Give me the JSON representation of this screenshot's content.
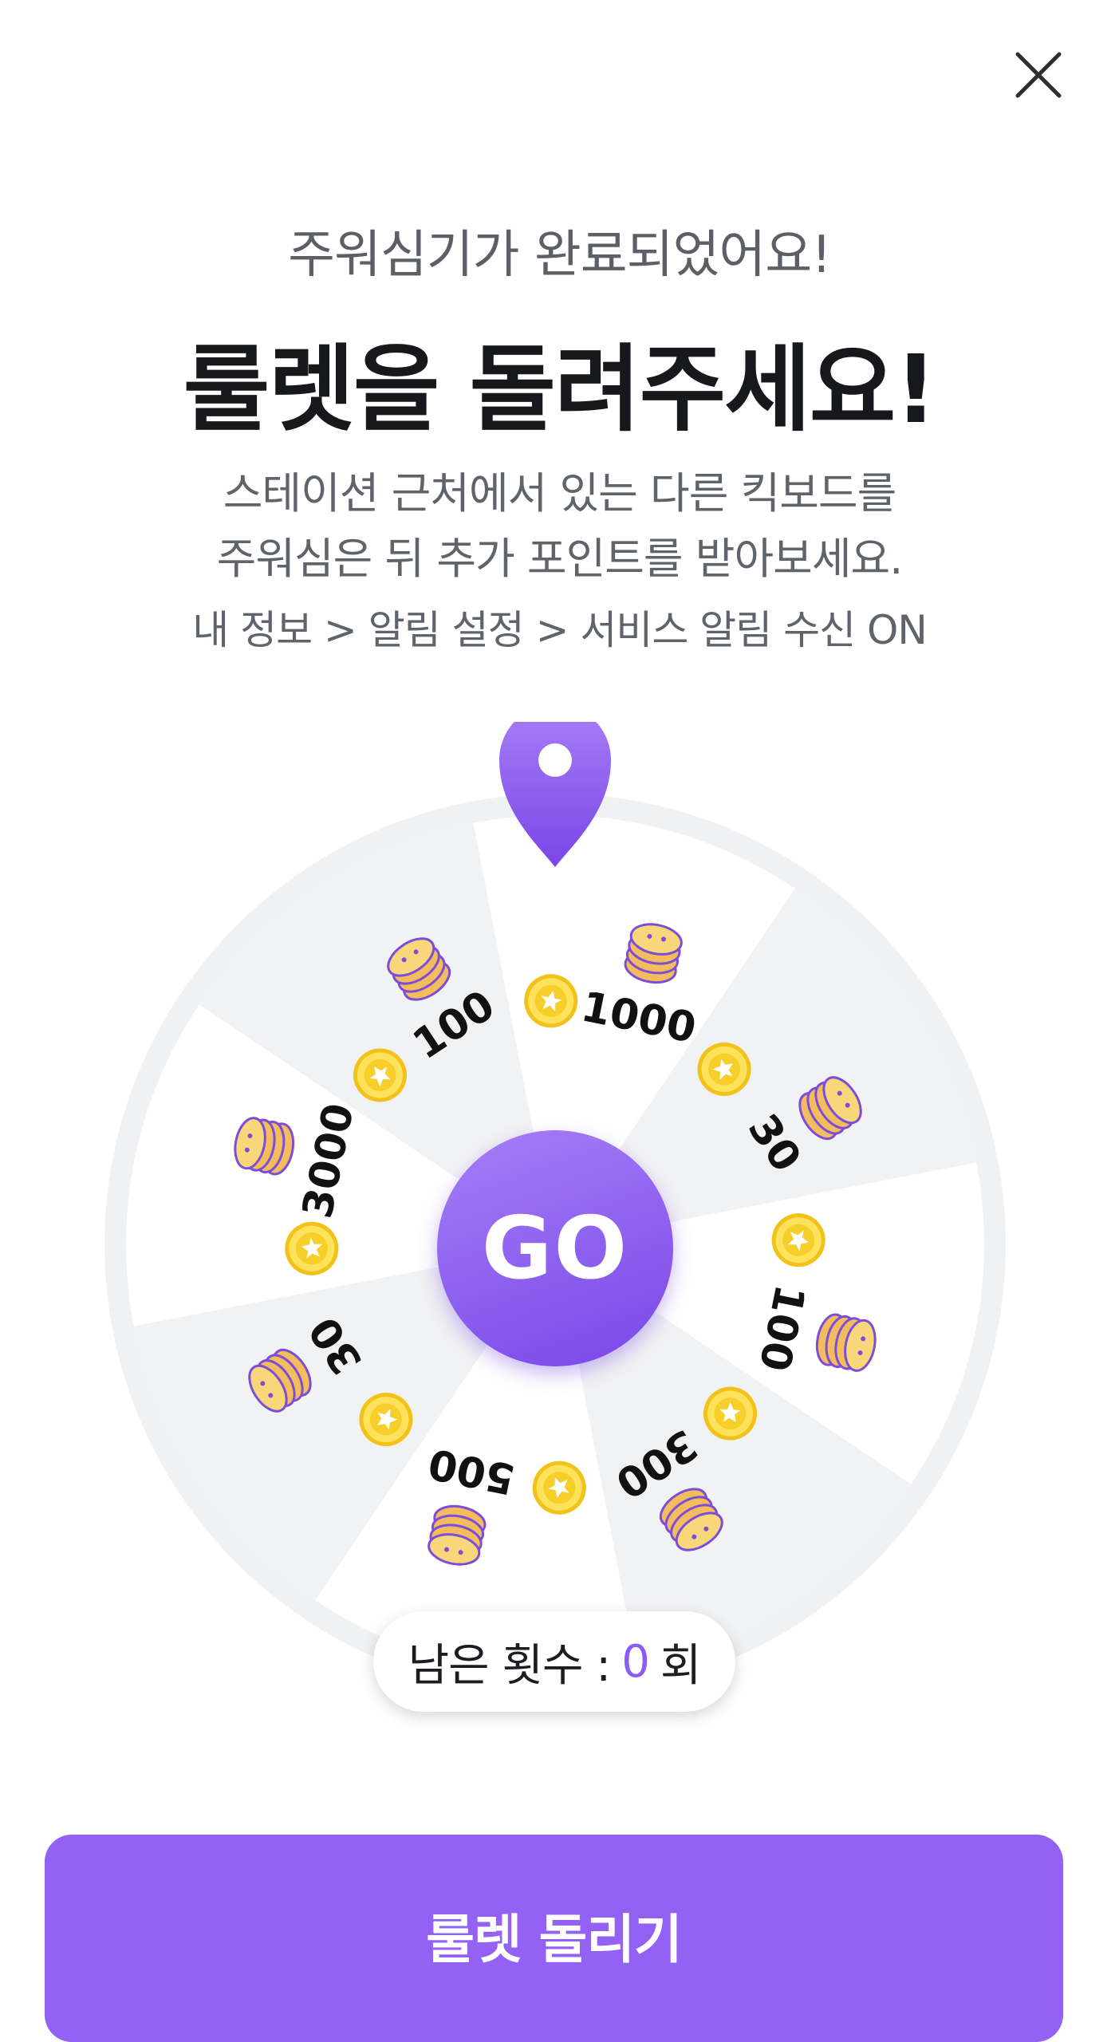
{
  "header": {
    "subtitle": "주워심기가 완료되었어요!",
    "title": "룰렛을 돌려주세요!",
    "description_line1": "스테이션 근처에서 있는 다른 킥보드를",
    "description_line2": "주워심은 뒤 추가 포인트를 받아보세요.",
    "settings_path": "내 정보 > 알림 설정 > 서비스 알림 수신 ON"
  },
  "wheel": {
    "segments": [
      {
        "label": "1000"
      },
      {
        "label": "30"
      },
      {
        "label": "100"
      },
      {
        "label": "300"
      },
      {
        "label": "500"
      },
      {
        "label": "30"
      },
      {
        "label": "3000"
      },
      {
        "label": "100"
      }
    ],
    "go_label": "GO",
    "accent_color": "#8c5cf6"
  },
  "remaining": {
    "prefix": "남은 횟수 :",
    "count": "0",
    "suffix": "회"
  },
  "actions": {
    "spin_label": "룰렛 돌리기"
  },
  "icons": {
    "close": "close-icon",
    "pointer": "map-pin-icon",
    "coin": "star-coin-icon",
    "stack": "coin-stack-icon"
  }
}
